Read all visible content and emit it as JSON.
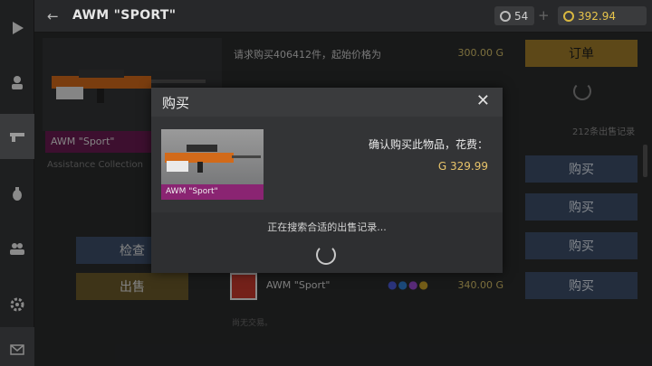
{
  "topbar": {
    "back_glyph": "←",
    "title": "AWM \"SPORT\"",
    "silver_amount": "54",
    "gold_amount": "392.94",
    "plus": "+"
  },
  "item": {
    "name": "AWM \"Sport\"",
    "collection": "Assistance Collection",
    "inspect_label": "检查",
    "sell_label": "出售"
  },
  "market": {
    "request_text": "请求购买406412件，起始价格为",
    "request_price": "300.00 G",
    "order_label": "订单",
    "records_count": "212条出售记录",
    "buy_labels": [
      "购买",
      "购买",
      "购买",
      "购买"
    ],
    "listing_name": "AWM \"Sport\"",
    "listing_price": "340.00 G",
    "no_trades": "尚无交易。"
  },
  "modal": {
    "title": "购买",
    "close": "✕",
    "item_name": "AWM \"Sport\"",
    "confirm_text": "确认购买此物品，花费：",
    "price": "G 329.99",
    "searching_text": "正在搜索合适的出售记录..."
  },
  "nav_icons": [
    "play-icon",
    "profile-icon",
    "weapon-icon",
    "grenade-icon",
    "friends-icon",
    "settings-icon",
    "mail-icon"
  ],
  "colors": {
    "accent_blue": "#3d4f6a",
    "accent_gold": "#a07d2a",
    "rarity_pink": "#8a2472",
    "price_gold": "#e8c46a"
  }
}
